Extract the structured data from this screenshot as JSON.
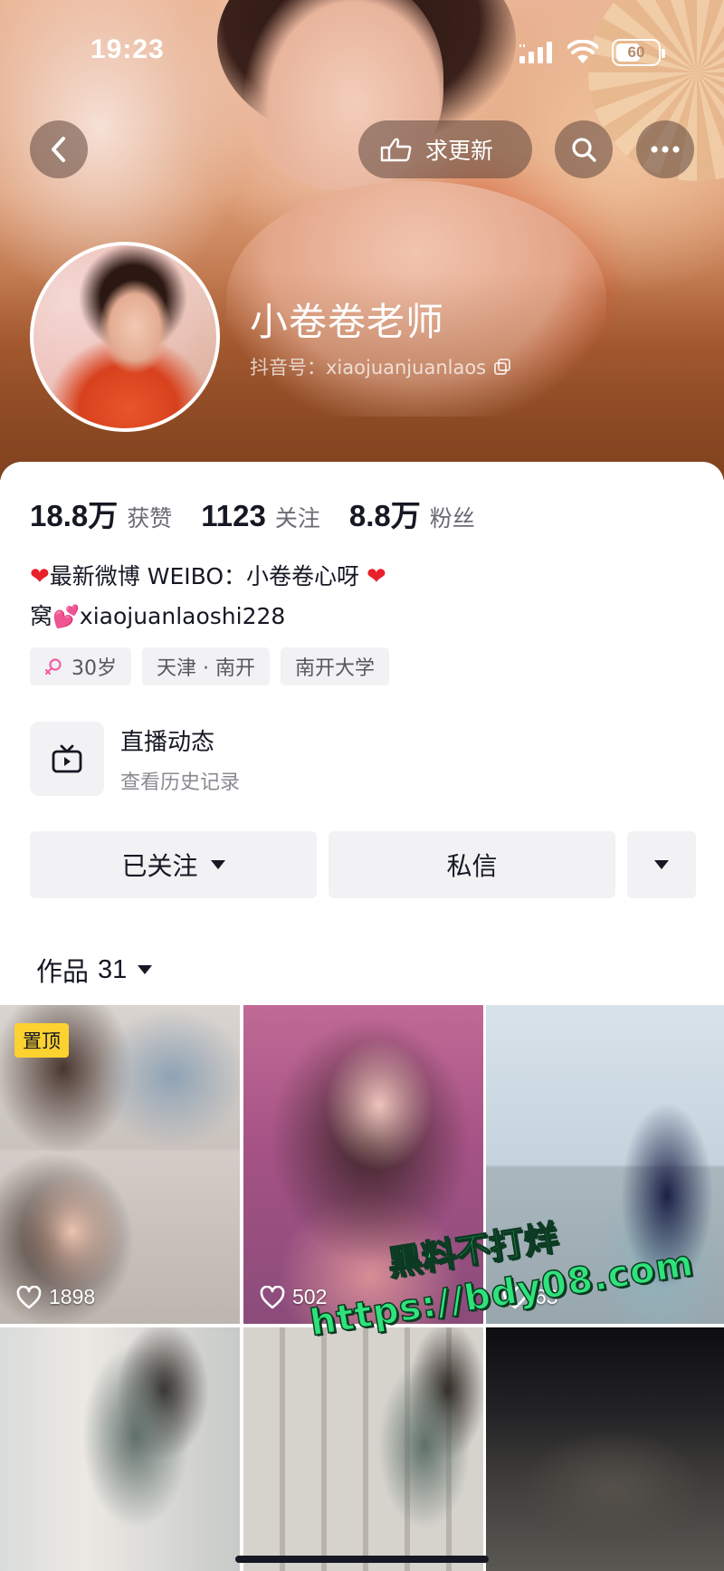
{
  "status_bar": {
    "time": "19:23",
    "battery_percent": "60",
    "battery_level": 0.6
  },
  "top_bar": {
    "request_update_label": "求更新"
  },
  "profile": {
    "name": "小卷卷老师",
    "douyin_id": "抖音号：xiaojuanjuanlaos"
  },
  "stats": [
    {
      "value": "18.8万",
      "label": "获赞"
    },
    {
      "value": "1123",
      "label": "关注"
    },
    {
      "value": "8.8万",
      "label": "粉丝"
    }
  ],
  "bio": {
    "line1": "最新微博 WEIBO：小卷卷心呀",
    "line2_prefix": "窝",
    "line2_handle": "xiaojuanlaoshi228"
  },
  "tags": {
    "age": "30岁",
    "location": "天津 · 南开",
    "school": "南开大学"
  },
  "live": {
    "title": "直播动态",
    "subtitle": "查看历史记录"
  },
  "actions": {
    "following_label": "已关注",
    "message_label": "私信"
  },
  "works": {
    "label": "作品",
    "count": "31"
  },
  "grid": {
    "pinned_label": "置顶",
    "tiles": [
      {
        "likes": "1898"
      },
      {
        "likes": "502"
      },
      {
        "likes": "63"
      }
    ]
  },
  "watermark": {
    "line1": "黑料不打烊",
    "line2": "https://bdy08.com"
  },
  "colors": {
    "accent_pinned": "#fbd230",
    "heart_red": "#e8202c",
    "watermark_green": "#2ee37a"
  }
}
